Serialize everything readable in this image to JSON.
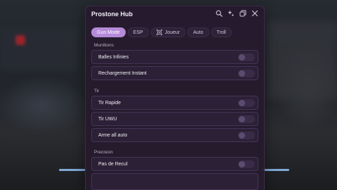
{
  "window": {
    "title": "Prostone Hub",
    "icons": [
      "search-icon",
      "sparkle-icon",
      "restore-icon",
      "close-icon"
    ]
  },
  "tabs": [
    {
      "label": "Gun Mode",
      "active": true
    },
    {
      "label": "ESP",
      "active": false
    },
    {
      "label": "Joueur",
      "active": false,
      "icon": "target-icon"
    },
    {
      "label": "Auto",
      "active": false
    },
    {
      "label": "Troll",
      "active": false
    }
  ],
  "sections": [
    {
      "label": "Munitions",
      "items": [
        {
          "label": "Balles Infinies",
          "enabled": false
        },
        {
          "label": "Rechargement Instant",
          "enabled": false
        }
      ]
    },
    {
      "label": "Tir",
      "items": [
        {
          "label": "Tir Rapide",
          "enabled": false
        },
        {
          "label": "Tir UWU",
          "enabled": false
        },
        {
          "label": "Arme all auto",
          "enabled": false
        }
      ]
    },
    {
      "label": "Precision",
      "items": [
        {
          "label": "Pas de Recul",
          "enabled": false
        }
      ]
    }
  ],
  "colors": {
    "accent": "#b58ad8",
    "panel_bg": "#261b2e",
    "row_bg": "#2c2036"
  }
}
